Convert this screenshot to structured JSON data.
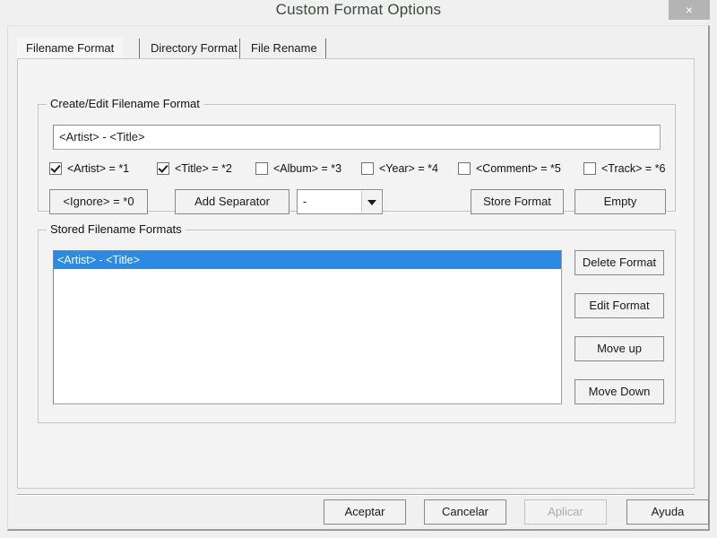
{
  "window": {
    "title": "Custom Format Options",
    "close_label": "×"
  },
  "tabs": [
    {
      "label": "Filename Format",
      "active": true
    },
    {
      "label": "Directory Format",
      "active": false
    },
    {
      "label": "File Rename",
      "active": false
    }
  ],
  "create_group": {
    "legend": "Create/Edit Filename Format",
    "format_input_value": "<Artist> - <Title>",
    "checkboxes": [
      {
        "label": "<Artist> = *1",
        "checked": true
      },
      {
        "label": "<Title> = *2",
        "checked": true
      },
      {
        "label": "<Album> = *3",
        "checked": false
      },
      {
        "label": "<Year> = *4",
        "checked": false
      },
      {
        "label": "<Comment> = *5",
        "checked": false
      },
      {
        "label": "<Track> = *6",
        "checked": false
      }
    ],
    "ignore_button": "<Ignore> = *0",
    "add_separator_button": "Add Separator",
    "separator_value": "-",
    "store_format_button": "Store Format",
    "empty_button": "Empty"
  },
  "stored_group": {
    "legend": "Stored Filename Formats",
    "items": [
      {
        "label": "<Artist> - <Title>",
        "selected": true
      }
    ],
    "delete_button": "Delete Format",
    "edit_button": "Edit Format",
    "move_up_button": "Move up",
    "move_down_button": "Move Down"
  },
  "footer": {
    "accept_button": "Aceptar",
    "cancel_button": "Cancelar",
    "apply_button": "Aplicar",
    "apply_disabled": true,
    "help_button": "Ayuda"
  },
  "colors": {
    "selection_blue": "#2b8ae3",
    "dialog_face": "#f0f0f0",
    "tabpage_face": "#f3f3f3",
    "title_text": "#3a4a3f",
    "close_button_bg": "#b4b4b4",
    "disabled_text": "#adadad"
  }
}
